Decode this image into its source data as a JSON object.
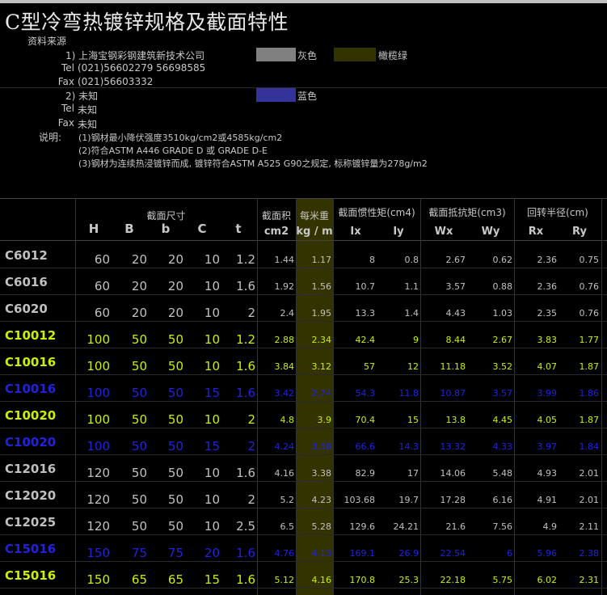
{
  "title": "C型冷弯热镀锌规格及截面特性",
  "source_label": "资料来源",
  "source1": {
    "name": "1) 上海宝钢彩钢建筑新技术公司",
    "tel_label": "Tel",
    "tel": "(021)56602279   56698585",
    "fax_label": "Fax",
    "fax": "(021)56603332"
  },
  "source2": {
    "name": "2) 未知",
    "tel_label": "Tel",
    "tel": "未知",
    "fax_label": "Fax",
    "fax": "未知"
  },
  "legend": {
    "gray": {
      "label": "灰色",
      "color": "#808080"
    },
    "olive": {
      "label": "橄榄绿",
      "color": "#333300"
    },
    "blue": {
      "label": "蓝色",
      "color": "#333399"
    }
  },
  "notes_label": "说明:",
  "notes": [
    "(1)钢材最小降伏强度3510kg/cm2或4585kg/cm2",
    "(2)符合ASTM  A446  GRADE  D 或 GRADE  D-E",
    "(3)钢材为连续热浸镀锌而成, 镀锌符合ASTM  A525  G90之规定, 标称镀锌量为278g/m2"
  ],
  "table": {
    "group_headers": {
      "section": "截面尺寸",
      "area": "截面积",
      "weight": "每米重",
      "inertia": "截面惯性矩(cm4)",
      "modulus": "截面抵抗矩(cm3)",
      "radius": "回转半径(cm)"
    },
    "columns": [
      "H",
      "B",
      "b",
      "C",
      "t",
      "cm2",
      "kg / m",
      "Ix",
      "Iy",
      "Wx",
      "Wy",
      "Rx",
      "Ry"
    ],
    "rows": [
      {
        "model": "C6012",
        "color": "gray",
        "vals": [
          "60",
          "20",
          "20",
          "10",
          "1.2",
          "1.44",
          "1.17",
          "8",
          "0.8",
          "2.67",
          "0.62",
          "2.36",
          "0.75"
        ]
      },
      {
        "model": "C6016",
        "color": "gray",
        "vals": [
          "60",
          "20",
          "20",
          "10",
          "1.6",
          "1.92",
          "1.56",
          "10.7",
          "1.1",
          "3.57",
          "0.88",
          "2.36",
          "0.76"
        ]
      },
      {
        "model": "C6020",
        "color": "gray",
        "vals": [
          "60",
          "20",
          "20",
          "10",
          "2",
          "2.4",
          "1.95",
          "13.3",
          "1.4",
          "4.43",
          "1.03",
          "2.35",
          "0.76"
        ]
      },
      {
        "model": "C10012",
        "color": "lime",
        "vals": [
          "100",
          "50",
          "50",
          "10",
          "1.2",
          "2.88",
          "2.34",
          "42.4",
          "9",
          "8.44",
          "2.67",
          "3.83",
          "1.77"
        ]
      },
      {
        "model": "C10016",
        "color": "lime",
        "vals": [
          "100",
          "50",
          "50",
          "10",
          "1.6",
          "3.84",
          "3.12",
          "57",
          "12",
          "11.18",
          "3.52",
          "4.07",
          "1.87"
        ]
      },
      {
        "model": "C10016",
        "color": "blue",
        "vals": [
          "100",
          "50",
          "50",
          "15",
          "1.6",
          "3.42",
          "2.74",
          "54.3",
          "11.8",
          "10.87",
          "3.57",
          "3.99",
          "1.86"
        ]
      },
      {
        "model": "C10020",
        "color": "lime",
        "vals": [
          "100",
          "50",
          "50",
          "10",
          "2",
          "4.8",
          "3.9",
          "70.4",
          "15",
          "13.8",
          "4.45",
          "4.05",
          "1.87"
        ]
      },
      {
        "model": "C10020",
        "color": "blue",
        "vals": [
          "100",
          "50",
          "50",
          "15",
          "2",
          "4.24",
          "3.38",
          "66.6",
          "14.3",
          "13.32",
          "4.33",
          "3.97",
          "1.84"
        ]
      },
      {
        "model": "C12016",
        "color": "gray",
        "vals": [
          "120",
          "50",
          "50",
          "10",
          "1.6",
          "4.16",
          "3.38",
          "82.9",
          "17",
          "14.06",
          "5.48",
          "4.93",
          "2.01"
        ]
      },
      {
        "model": "C12020",
        "color": "gray",
        "vals": [
          "120",
          "50",
          "50",
          "10",
          "2",
          "5.2",
          "4.23",
          "103.68",
          "19.7",
          "17.28",
          "6.16",
          "4.91",
          "2.01"
        ]
      },
      {
        "model": "C12025",
        "color": "gray",
        "vals": [
          "120",
          "50",
          "50",
          "10",
          "2.5",
          "6.5",
          "5.28",
          "129.6",
          "24.21",
          "21.6",
          "7.56",
          "4.9",
          "2.11"
        ]
      },
      {
        "model": "C15016",
        "color": "blue",
        "vals": [
          "150",
          "75",
          "75",
          "20",
          "1.6",
          "4.76",
          "4.13",
          "169.1",
          "26.9",
          "22.54",
          "6",
          "5.96",
          "2.38"
        ]
      },
      {
        "model": "C15016",
        "color": "lime",
        "vals": [
          "150",
          "65",
          "65",
          "15",
          "1.6",
          "5.12",
          "4.16",
          "170.8",
          "25.3",
          "22.18",
          "5.75",
          "6.02",
          "2.31"
        ]
      }
    ]
  }
}
